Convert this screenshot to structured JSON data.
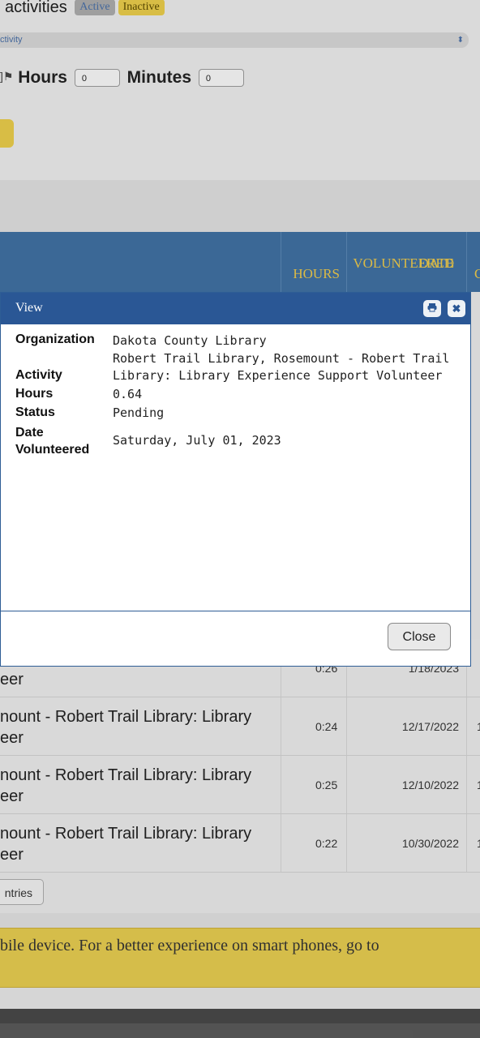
{
  "filters": {
    "activities_label": "activities",
    "active_pill": "Active",
    "inactive_pill": "Inactive",
    "activity_select_value": "ctivity",
    "hours_label": "Hours",
    "hours_value": "0",
    "minutes_label": "Minutes",
    "minutes_value": "0"
  },
  "table": {
    "col_hours": "HOURS",
    "col_date_line1": "DATE",
    "col_date_line2": "VOLUNTEERED",
    "col_more": "C",
    "rows": [
      {
        "activity_line1": "",
        "activity_line2": "eer",
        "hours": "0:26",
        "date": "1/18/2023",
        "more": ""
      },
      {
        "activity_line1": "nount - Robert Trail Library: Library",
        "activity_line2": "eer",
        "hours": "0:24",
        "date": "12/17/2022",
        "more": "1"
      },
      {
        "activity_line1": "nount - Robert Trail Library: Library",
        "activity_line2": "eer",
        "hours": "0:25",
        "date": "12/10/2022",
        "more": "1"
      },
      {
        "activity_line1": "nount - Robert Trail Library: Library",
        "activity_line2": "eer",
        "hours": "0:22",
        "date": "10/30/2022",
        "more": "1"
      }
    ],
    "entries_button": "ntries"
  },
  "notice": {
    "text": "bile device. For a better experience on smart phones, go to"
  },
  "dialog": {
    "title": "View",
    "print_icon": "print-icon",
    "close_icon": "close-icon",
    "fields": {
      "organization_label": "Organization",
      "organization_value": "Dakota County Library",
      "activity_label": "Activity",
      "activity_value_line1": "Robert Trail Library, Rosemount - Robert Trail",
      "activity_value_line2": "Library: Library Experience Support Volunteer",
      "hours_label": "Hours",
      "hours_value": "0.64",
      "status_label": "Status",
      "status_value": "Pending",
      "date_label_line1": "Date",
      "date_label_line2": "Volunteered",
      "date_value": "Saturday, July 01, 2023"
    },
    "close_button": "Close"
  },
  "colors": {
    "header_blue": "#3f6fa0",
    "dialog_title_blue": "#2a5795",
    "accent_yellow": "#e6c94a"
  }
}
